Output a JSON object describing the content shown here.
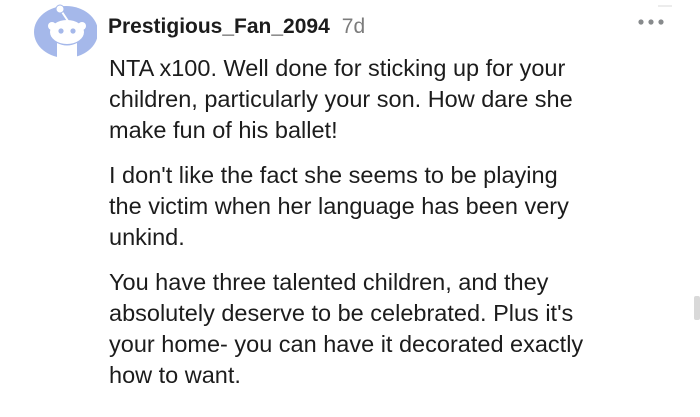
{
  "comment": {
    "author": "Prestigious_Fan_2094",
    "time_ago": "7d",
    "avatar_icon": "snoo-avatar-icon",
    "more_icon": "more-options-icon",
    "avatar_bg": "#a5b8ea",
    "paragraphs": [
      "NTA x100. Well done for sticking up for your\nchildren, particularly your son. How dare she\nmake fun of his ballet!",
      "I don't like the fact she seems to be playing\nthe victim when her language has been very\nunkind.",
      "You have three talented children, and they\nabsolutely deserve to be celebrated. Plus it's\nyour home- you can have it decorated exactly\nhow to want."
    ]
  }
}
